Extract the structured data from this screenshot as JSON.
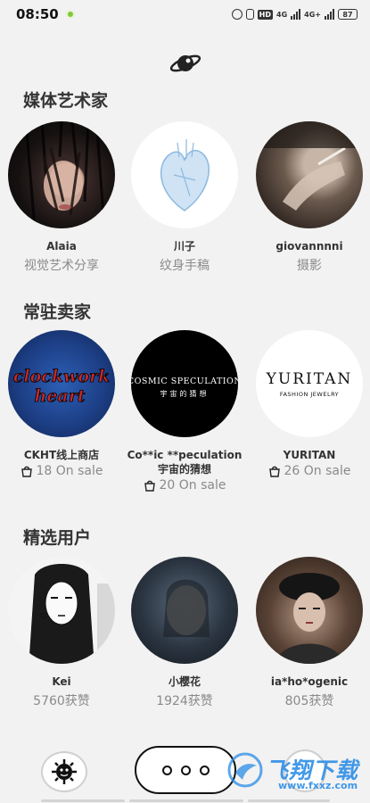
{
  "status_bar": {
    "time": "08:50",
    "hd": "HD",
    "net1": "4G",
    "net2": "4G+",
    "battery": "87"
  },
  "sections": [
    {
      "title": "媒体艺术家",
      "items": [
        {
          "name": "Alaia",
          "sub": "视觉艺术分享"
        },
        {
          "name": "川子",
          "sub": "纹身手稿"
        },
        {
          "name": "giovannnni",
          "sub": "摄影"
        }
      ]
    },
    {
      "title": "常驻卖家",
      "items": [
        {
          "name": "CKHT线上商店",
          "sale": "18 On sale",
          "logo_text": "clockwork heart"
        },
        {
          "name": "Co**ic **peculation宇宙的猜想",
          "sale": "20 On sale",
          "logo_text": "COSMIC SPECULATION",
          "logo_sub": "宇宙的猜想"
        },
        {
          "name": "YURITAN",
          "sale": "26 On sale",
          "logo_text": "YURITAN",
          "logo_sub": "FASHION JEWELRY"
        }
      ]
    },
    {
      "title": "精选用户",
      "items": [
        {
          "name": "Kei",
          "sub": "5760获赞"
        },
        {
          "name": "小樱花",
          "sub": "1924获赞"
        },
        {
          "name": "ia*ho*ogenic",
          "sub": "805获赞"
        }
      ]
    }
  ],
  "watermark": {
    "text": "飞翔下载",
    "url": "www.fxxz.com"
  },
  "colors": {
    "background": "#f2f2f2",
    "accent_watermark": "#2d8ee6"
  }
}
